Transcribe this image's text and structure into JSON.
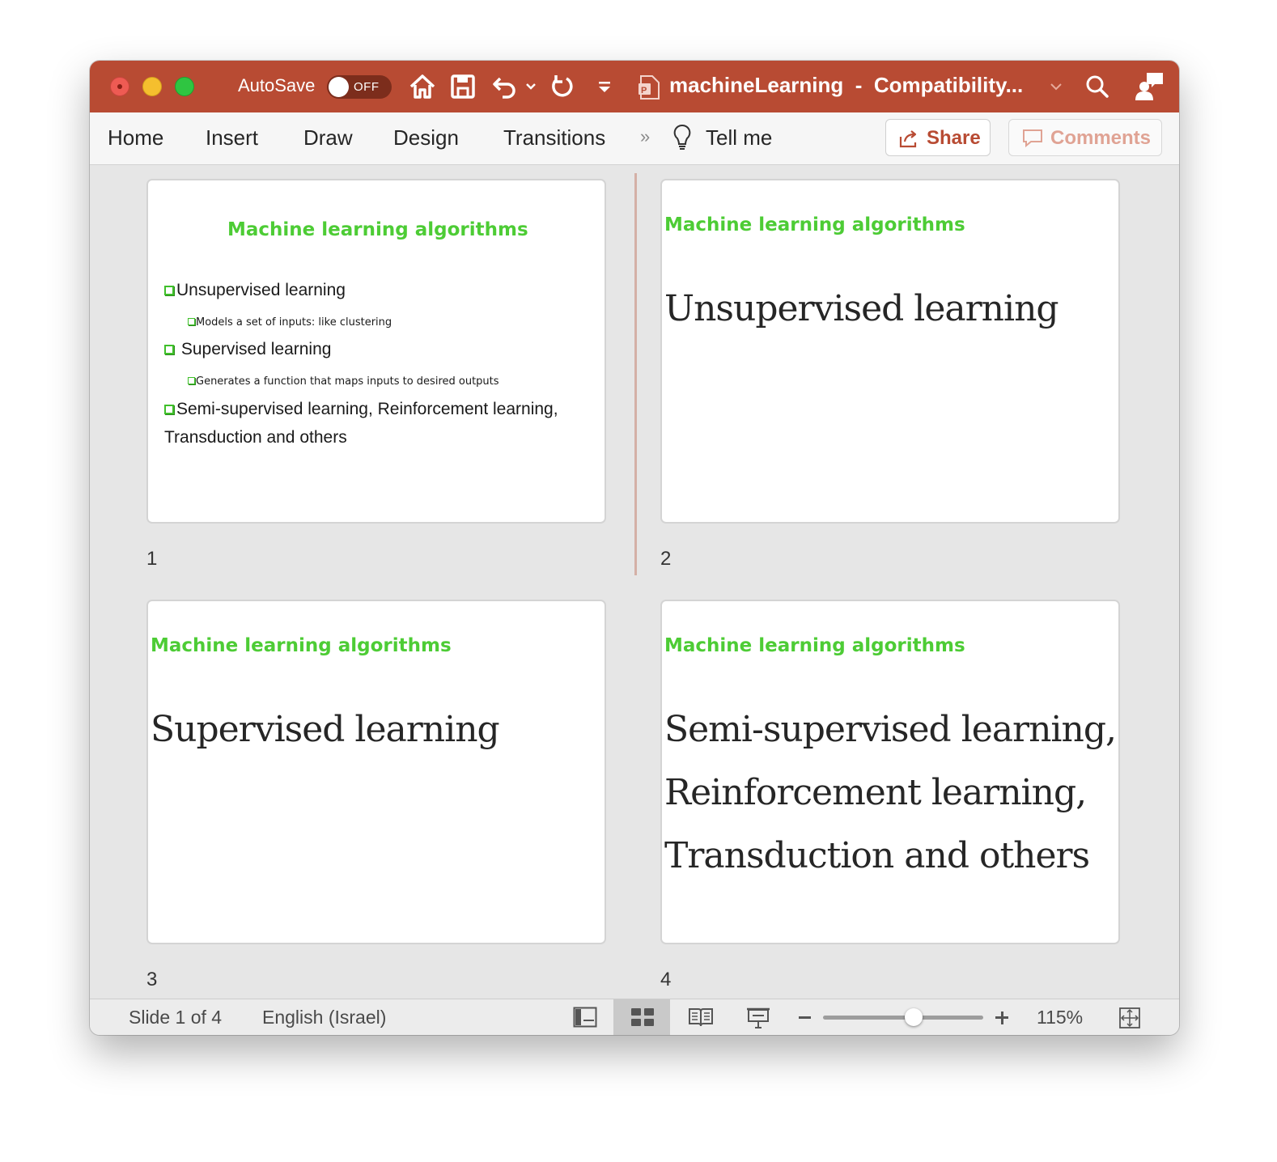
{
  "titlebar": {
    "autosave_label": "AutoSave",
    "autosave_state": "OFF",
    "doc_title": "machineLearning  -  Compatibility...",
    "accent_color": "#b84b33"
  },
  "ribbon": {
    "tabs": [
      "Home",
      "Insert",
      "Draw",
      "Design",
      "Transitions"
    ],
    "overflow": "»",
    "tell_me": "Tell me",
    "share": "Share",
    "comments": "Comments"
  },
  "slides": [
    {
      "number": "1",
      "title": "Machine learning algorithms",
      "bullets": [
        {
          "text": "Unsupervised learning",
          "sub": "Models a set of inputs: like clustering"
        },
        {
          "text": " Supervised learning",
          "sub": "Generates a function that maps inputs to desired outputs"
        },
        {
          "text": "Semi-supervised learning, Reinforcement learning,",
          "cont": "Transduction and others"
        }
      ]
    },
    {
      "number": "2",
      "title": "Machine learning algorithms",
      "body": [
        "Unsupervised learning"
      ]
    },
    {
      "number": "3",
      "title": "Machine learning algorithms",
      "body": [
        "Supervised learning"
      ]
    },
    {
      "number": "4",
      "title": "Machine learning algorithms",
      "body": [
        "Semi-supervised learning,",
        "Reinforcement learning,",
        "Transduction and others"
      ]
    }
  ],
  "statusbar": {
    "slide_info": "Slide 1 of 4",
    "language": "English (Israel)",
    "zoom": "115%",
    "active_view": "slide-sorter"
  },
  "colors": {
    "title_green": "#4dcc35",
    "window_bg": "#e6e6e6"
  }
}
